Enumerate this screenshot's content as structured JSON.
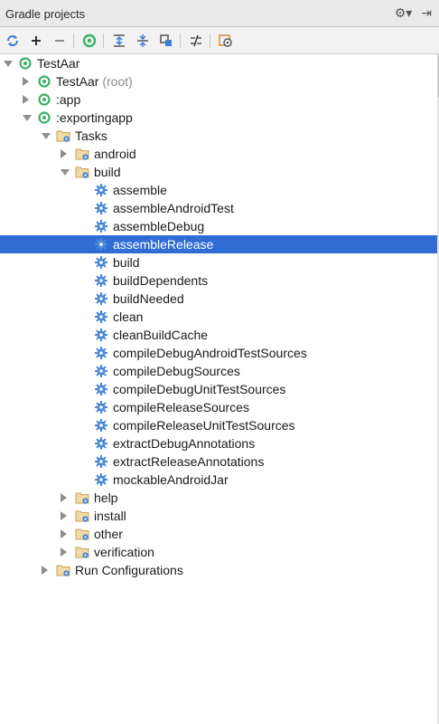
{
  "panel": {
    "title": "Gradle projects",
    "title_tools": [
      {
        "name": "gear-dropdown-icon",
        "glyph": "⚙▾"
      },
      {
        "name": "hide-panel-icon",
        "glyph": "⇥"
      }
    ]
  },
  "colors": {
    "accent": "#2f6dd5",
    "gradle_green": "#3db16a",
    "folder": "#c9a15a",
    "gear_blue": "#4b8ad6"
  },
  "tree": [
    {
      "label": "TestAar",
      "suffix": "",
      "depth": 0,
      "icon": "gradle-project-icon",
      "arrow": "down"
    },
    {
      "label": "TestAar",
      "suffix": " (root)",
      "depth": 1,
      "icon": "gradle-project-icon",
      "arrow": "right"
    },
    {
      "label": ":app",
      "suffix": "",
      "depth": 1,
      "icon": "gradle-project-icon",
      "arrow": "right"
    },
    {
      "label": ":exportingapp",
      "suffix": "",
      "depth": 1,
      "icon": "gradle-project-icon",
      "arrow": "down"
    },
    {
      "label": "Tasks",
      "suffix": "",
      "depth": 2,
      "icon": "task-folder-icon",
      "arrow": "down"
    },
    {
      "label": "android",
      "suffix": "",
      "depth": 3,
      "icon": "task-folder-icon",
      "arrow": "right"
    },
    {
      "label": "build",
      "suffix": "",
      "depth": 3,
      "icon": "task-folder-icon",
      "arrow": "down"
    },
    {
      "label": "assemble",
      "suffix": "",
      "depth": 4,
      "icon": "gear-icon",
      "arrow": ""
    },
    {
      "label": "assembleAndroidTest",
      "suffix": "",
      "depth": 4,
      "icon": "gear-icon",
      "arrow": ""
    },
    {
      "label": "assembleDebug",
      "suffix": "",
      "depth": 4,
      "icon": "gear-icon",
      "arrow": ""
    },
    {
      "label": "assembleRelease",
      "suffix": "",
      "depth": 4,
      "icon": "gear-icon",
      "arrow": "",
      "selected": true
    },
    {
      "label": "build",
      "suffix": "",
      "depth": 4,
      "icon": "gear-icon",
      "arrow": ""
    },
    {
      "label": "buildDependents",
      "suffix": "",
      "depth": 4,
      "icon": "gear-icon",
      "arrow": ""
    },
    {
      "label": "buildNeeded",
      "suffix": "",
      "depth": 4,
      "icon": "gear-icon",
      "arrow": ""
    },
    {
      "label": "clean",
      "suffix": "",
      "depth": 4,
      "icon": "gear-icon",
      "arrow": ""
    },
    {
      "label": "cleanBuildCache",
      "suffix": "",
      "depth": 4,
      "icon": "gear-icon",
      "arrow": ""
    },
    {
      "label": "compileDebugAndroidTestSources",
      "suffix": "",
      "depth": 4,
      "icon": "gear-icon",
      "arrow": ""
    },
    {
      "label": "compileDebugSources",
      "suffix": "",
      "depth": 4,
      "icon": "gear-icon",
      "arrow": ""
    },
    {
      "label": "compileDebugUnitTestSources",
      "suffix": "",
      "depth": 4,
      "icon": "gear-icon",
      "arrow": ""
    },
    {
      "label": "compileReleaseSources",
      "suffix": "",
      "depth": 4,
      "icon": "gear-icon",
      "arrow": ""
    },
    {
      "label": "compileReleaseUnitTestSources",
      "suffix": "",
      "depth": 4,
      "icon": "gear-icon",
      "arrow": ""
    },
    {
      "label": "extractDebugAnnotations",
      "suffix": "",
      "depth": 4,
      "icon": "gear-icon",
      "arrow": ""
    },
    {
      "label": "extractReleaseAnnotations",
      "suffix": "",
      "depth": 4,
      "icon": "gear-icon",
      "arrow": ""
    },
    {
      "label": "mockableAndroidJar",
      "suffix": "",
      "depth": 4,
      "icon": "gear-icon",
      "arrow": ""
    },
    {
      "label": "help",
      "suffix": "",
      "depth": 3,
      "icon": "task-folder-icon",
      "arrow": "right"
    },
    {
      "label": "install",
      "suffix": "",
      "depth": 3,
      "icon": "task-folder-icon",
      "arrow": "right"
    },
    {
      "label": "other",
      "suffix": "",
      "depth": 3,
      "icon": "task-folder-icon",
      "arrow": "right"
    },
    {
      "label": "verification",
      "suffix": "",
      "depth": 3,
      "icon": "task-folder-icon",
      "arrow": "right"
    },
    {
      "label": "Run Configurations",
      "suffix": "",
      "depth": 2,
      "icon": "task-folder-icon",
      "arrow": "right"
    }
  ]
}
